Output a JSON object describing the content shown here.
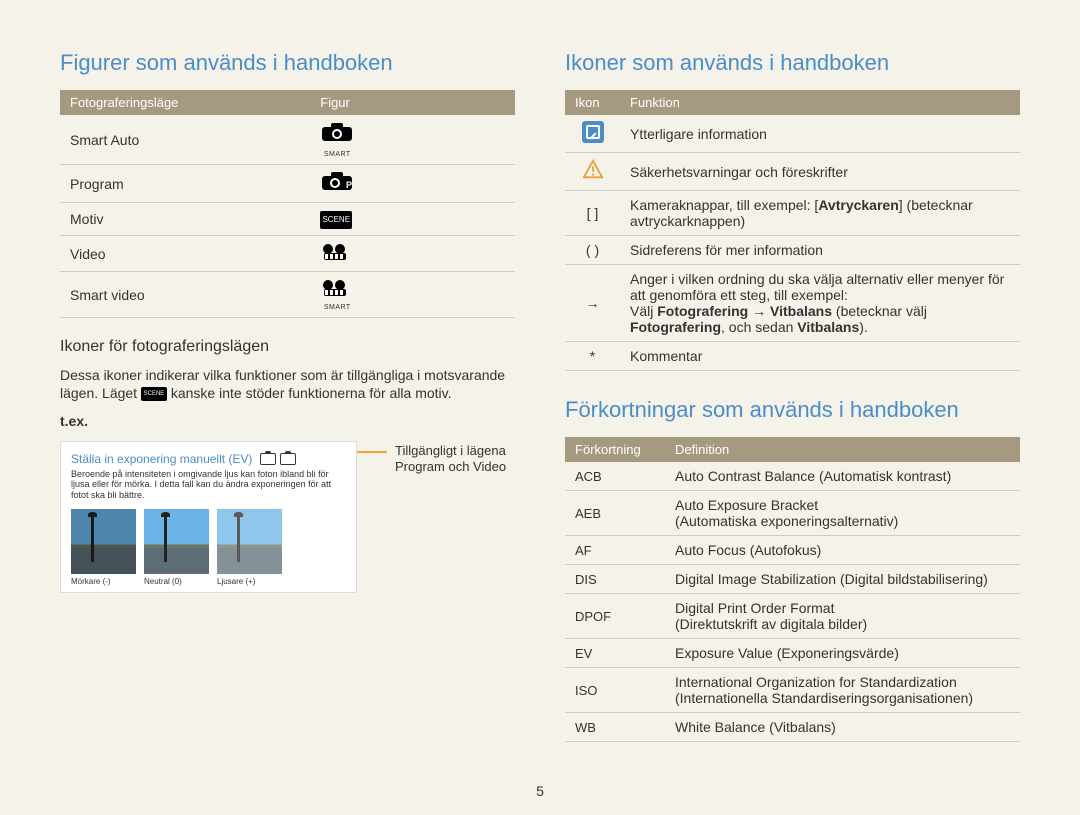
{
  "left": {
    "heading": "Figurer som används i handboken",
    "table": {
      "head": {
        "mode": "Fotograferingsläge",
        "figure": "Figur"
      },
      "rows": [
        {
          "mode": "Smart Auto",
          "icon": "camera-smart-icon"
        },
        {
          "mode": "Program",
          "icon": "camera-p-icon"
        },
        {
          "mode": "Motiv",
          "icon": "scene-icon"
        },
        {
          "mode": "Video",
          "icon": "video-icon"
        },
        {
          "mode": "Smart video",
          "icon": "video-smart-icon"
        }
      ]
    },
    "sub_heading": "Ikoner för fotograferingslägen",
    "para": "Dessa ikoner indikerar vilka funktioner som är tillgängliga i motsvarande lägen. Läget ▮ kanske inte stöder funktionerna för alla motiv.",
    "tex_label": "t.ex.",
    "example": {
      "title": "Ställa in exponering manuellt (EV)",
      "caption": "Beroende på intensiteten i omgivande ljus kan foton ibland bli för ljusa eller för mörka. I detta fall kan du ändra exponeringen för att fotot ska bli bättre.",
      "thumbs": [
        {
          "label": "Mörkare (-)"
        },
        {
          "label": "Neutral (0)"
        },
        {
          "label": "Ljusare (+)"
        }
      ]
    },
    "side_note": "Tillgängligt i lägena Program och Video"
  },
  "right": {
    "icons_heading": "Ikoner som används i handboken",
    "icons_table": {
      "head": {
        "icon": "Ikon",
        "func": "Funktion"
      },
      "rows": [
        {
          "icon_type": "info",
          "text": "Ytterligare information"
        },
        {
          "icon_type": "warn",
          "text": "Säkerhetsvarningar och föreskrifter"
        },
        {
          "icon_type": "text",
          "icon_text": "[  ]",
          "html": "Kameraknappar, till exempel: [<b>Avtryckaren</b>] (betecknar avtryckarknappen)"
        },
        {
          "icon_type": "text",
          "icon_text": "(  )",
          "text": "Sidreferens för mer information"
        },
        {
          "icon_type": "text",
          "icon_text": "→",
          "html": "Anger i vilken ordning du ska välja alternativ eller menyer för att genomföra ett steg, till exempel:<br>Välj <b>Fotografering</b> → <b>Vitbalans</b> (betecknar välj <b>Fotografering</b>, och sedan <b>Vitbalans</b>)."
        },
        {
          "icon_type": "text",
          "icon_text": "*",
          "text": "Kommentar"
        }
      ]
    },
    "abbrev_heading": "Förkortningar som används i handboken",
    "abbrev_table": {
      "head": {
        "abbr": "Förkortning",
        "def": "Definition"
      },
      "rows": [
        {
          "abbr": "ACB",
          "def": "Auto Contrast Balance (Automatisk kontrast)"
        },
        {
          "abbr": "AEB",
          "def": "Auto Exposure Bracket\n(Automatiska exponeringsalternativ)"
        },
        {
          "abbr": "AF",
          "def": "Auto Focus (Autofokus)"
        },
        {
          "abbr": "DIS",
          "def": "Digital Image Stabilization (Digital bildstabilisering)"
        },
        {
          "abbr": "DPOF",
          "def": "Digital Print Order Format\n(Direktutskrift av digitala bilder)"
        },
        {
          "abbr": "EV",
          "def": "Exposure Value (Exponeringsvärde)"
        },
        {
          "abbr": "ISO",
          "def": "International Organization for Standardization\n(Internationella Standardiseringsorganisationen)"
        },
        {
          "abbr": "WB",
          "def": "White Balance (Vitbalans)"
        }
      ]
    }
  },
  "page_number": "5"
}
